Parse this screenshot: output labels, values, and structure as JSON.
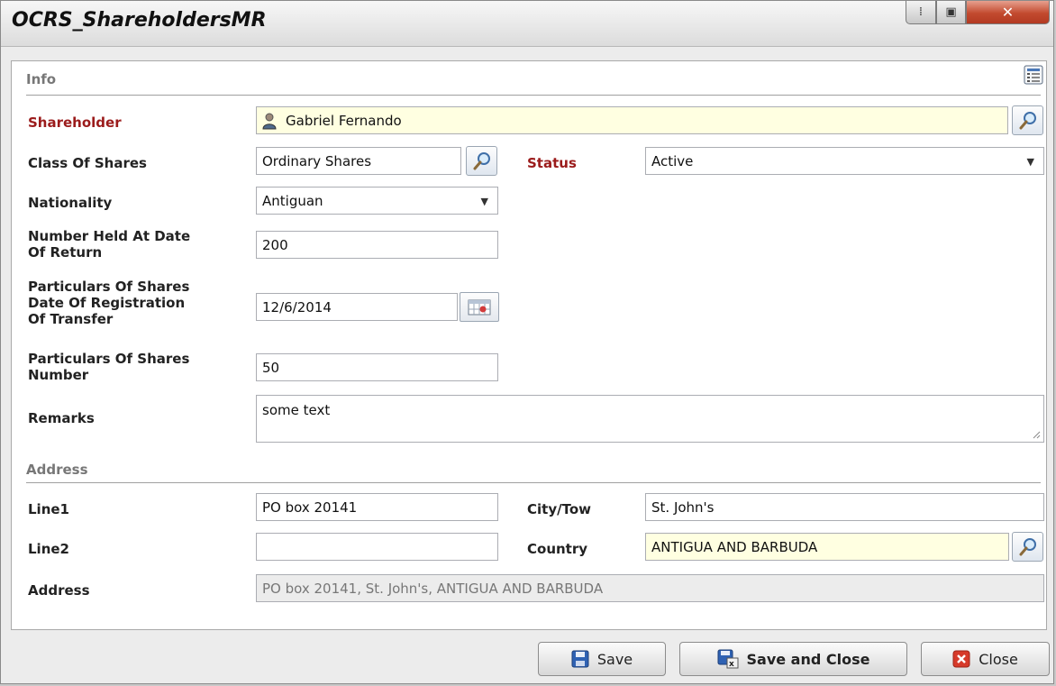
{
  "window": {
    "title": "OCRS_ShareholdersMR",
    "restore_glyph": "⁞",
    "maximize_glyph": "▣",
    "close_glyph": "✕"
  },
  "info_section": {
    "title": "Info",
    "shareholder": {
      "label": "Shareholder",
      "value": "Gabriel Fernando"
    },
    "class_of_shares": {
      "label": "Class Of Shares",
      "value": "Ordinary Shares"
    },
    "status": {
      "label": "Status",
      "value": "Active"
    },
    "nationality": {
      "label": "Nationality",
      "value": "Antiguan"
    },
    "number_held": {
      "label_line1": "Number Held At Date",
      "label_line2": "Of Return",
      "value": "200"
    },
    "date_registration": {
      "label_line1": "Particulars Of Shares",
      "label_line2": "Date Of Registration",
      "label_line3": "Of Transfer",
      "value": "12/6/2014"
    },
    "shares_number": {
      "label_line1": "Particulars Of Shares",
      "label_line2": "Number",
      "value": "50"
    },
    "remarks": {
      "label": "Remarks",
      "value": "some text"
    }
  },
  "address_section": {
    "title": "Address",
    "line1": {
      "label": "Line1",
      "value": "PO box 20141"
    },
    "city": {
      "label": "City/Tow",
      "value": "St. John's"
    },
    "line2": {
      "label": "Line2",
      "value": ""
    },
    "country": {
      "label": "Country",
      "value": "ANTIGUA AND BARBUDA"
    },
    "address": {
      "label": "Address",
      "value": "PO box 20141, St. John's, ANTIGUA AND BARBUDA"
    }
  },
  "buttons": {
    "save": "Save",
    "save_and_close": "Save and Close",
    "close": "Close"
  },
  "colors": {
    "required_label": "#9b1b1b",
    "lookup_field_bg": "#ffffe1",
    "readonly_bg": "#ececec"
  }
}
